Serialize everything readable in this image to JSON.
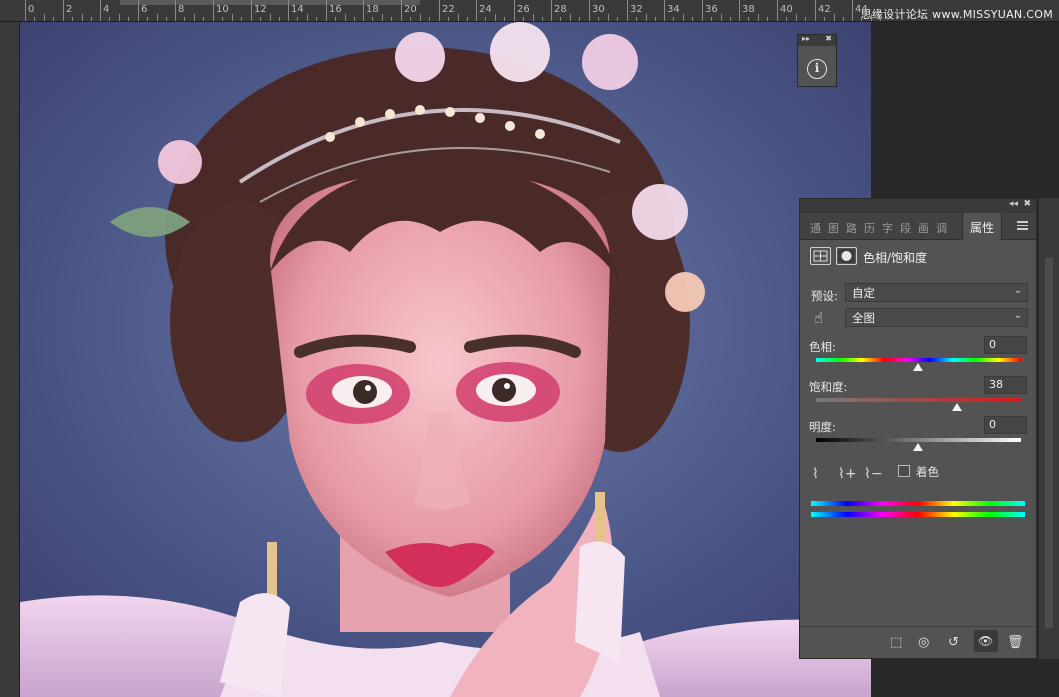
{
  "ruler": {
    "labels": [
      "0",
      "2",
      "4",
      "6",
      "8",
      "10",
      "12",
      "14",
      "16",
      "18",
      "20",
      "22",
      "24",
      "26",
      "28",
      "30",
      "32",
      "34",
      "36",
      "38",
      "40",
      "42",
      "44"
    ]
  },
  "watermark": "思缘设计论坛 www.MISSYUAN.COM",
  "info_panel": {
    "collapse_glyph": "▸▸",
    "close_glyph": "✖",
    "info_glyph": "i"
  },
  "properties_panel": {
    "topbar_collapse": "◂◂",
    "topbar_close": "✖",
    "tabs": [
      "通",
      "图",
      "路",
      "历",
      "字",
      "段",
      "画",
      "调"
    ],
    "active_tab": "属性",
    "adjustment_title": "色相/饱和度",
    "preset": {
      "label": "预设:",
      "value": "自定"
    },
    "channel": {
      "value": "全图"
    },
    "hue": {
      "label": "色相:",
      "value": "0"
    },
    "saturation": {
      "label": "饱和度:",
      "value": "38"
    },
    "lightness": {
      "label": "明度:",
      "value": "0"
    },
    "colorize_label": "着色",
    "chevron": "⌄",
    "hand_glyph": "☝",
    "dropper_glyphs": [
      "⌇",
      "⌇+",
      "⌇−"
    ],
    "footer_glyphs": [
      "⬚",
      "◎",
      "↺",
      "👁",
      "🗑"
    ]
  },
  "colors": {
    "panel_bg": "#535353",
    "dark_bg": "#282828",
    "accent_text": "#f0f0f0"
  }
}
